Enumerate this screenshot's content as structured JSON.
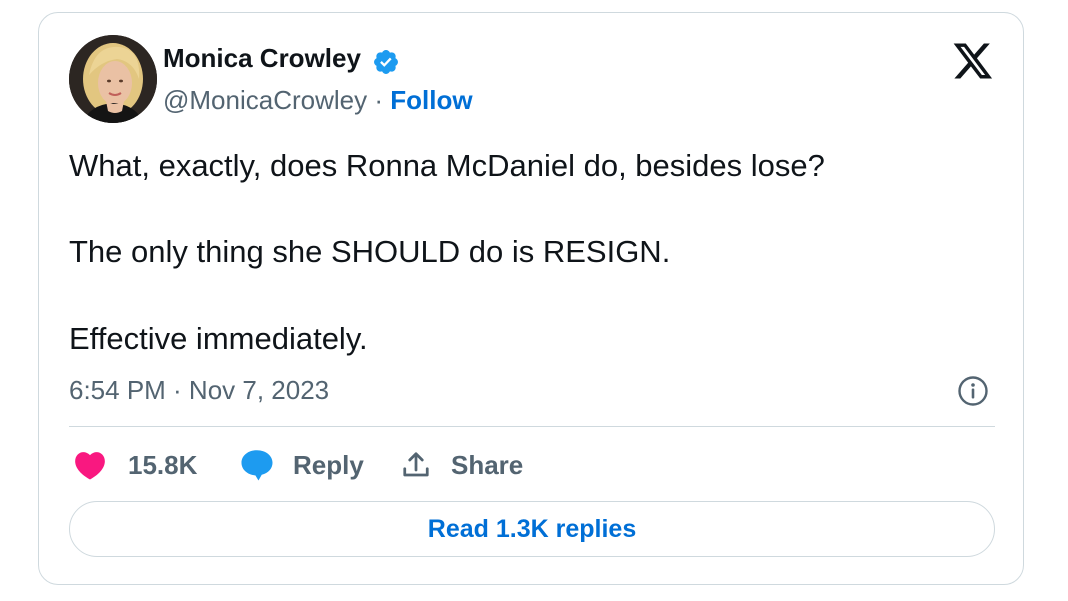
{
  "author": {
    "display_name": "Monica Crowley",
    "handle": "@MonicaCrowley",
    "separator": " · ",
    "follow_label": "Follow",
    "verified": true
  },
  "tweet": {
    "lines": [
      "What, exactly, does Ronna McDaniel do, besides lose?",
      "The only thing she SHOULD do is RESIGN.",
      "Effective immediately."
    ],
    "timestamp": "6:54 PM · Nov 7, 2023"
  },
  "actions": {
    "like_count": "15.8K",
    "reply_label": "Reply",
    "share_label": "Share"
  },
  "read_replies_label": "Read 1.3K replies",
  "icons": {
    "brand": "x-logo-icon",
    "verified": "verified-badge-icon",
    "info": "info-icon",
    "like": "heart-icon",
    "reply": "speech-bubble-icon",
    "share": "share-upload-icon"
  },
  "colors": {
    "text_primary": "#0f1419",
    "text_secondary": "#536471",
    "link_blue": "#006fd6",
    "verified_blue": "#1d9bf0",
    "like_pink": "#f91880",
    "border": "#cfd9de"
  }
}
